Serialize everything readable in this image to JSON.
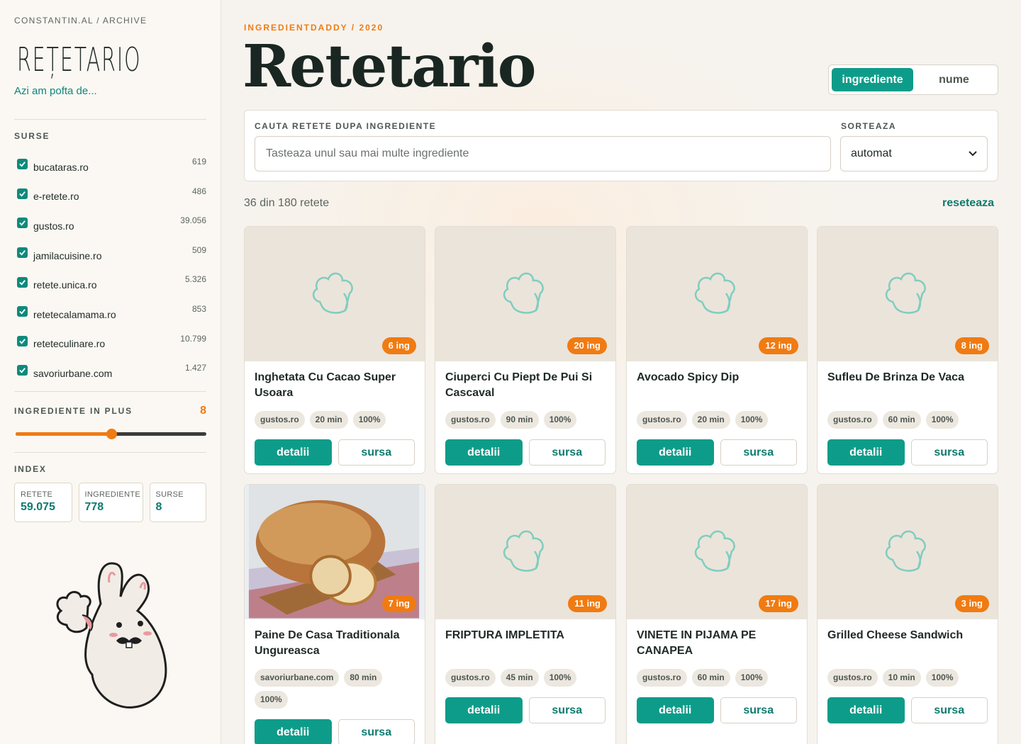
{
  "sidebar": {
    "crumb": "CONSTANTIN.AL / ARCHIVE",
    "logo": "REȚETARIO",
    "tagline": "Azi am pofta de...",
    "sources_title": "SURSE",
    "sources": [
      {
        "name": "bucataras.ro",
        "count": "619",
        "checked": true
      },
      {
        "name": "e-retete.ro",
        "count": "486",
        "checked": true
      },
      {
        "name": "gustos.ro",
        "count": "39.056",
        "checked": true
      },
      {
        "name": "jamilacuisine.ro",
        "count": "509",
        "checked": true
      },
      {
        "name": "retete.unica.ro",
        "count": "5.326",
        "checked": true
      },
      {
        "name": "retetecalamama.ro",
        "count": "853",
        "checked": true
      },
      {
        "name": "reteteculinare.ro",
        "count": "10.799",
        "checked": true
      },
      {
        "name": "savoriurbane.com",
        "count": "1.427",
        "checked": true
      }
    ],
    "ingredients_plus_title": "INGREDIENTE IN PLUS",
    "ingredients_plus_value": "8",
    "slider_fraction": 0.5,
    "index_title": "INDEX",
    "stats": [
      {
        "label": "RETETE",
        "value": "59.075"
      },
      {
        "label": "INGREDIENTE",
        "value": "778"
      },
      {
        "label": "SURSE",
        "value": "8"
      }
    ]
  },
  "header": {
    "kicker": "INGREDIENTDADDY / 2020",
    "title": "Retetario",
    "toggle": {
      "active": "ingrediente",
      "inactive": "nume"
    }
  },
  "search": {
    "label": "CAUTA RETETE DUPA INGREDIENTE",
    "placeholder": "Tasteaza unul sau mai multe ingrediente",
    "sort_label": "SORTEAZA",
    "sort_value": "automat"
  },
  "results": {
    "count_text": "36 din 180 retete",
    "reset_label": "reseteaza"
  },
  "card_labels": {
    "details": "detalii",
    "source": "sursa"
  },
  "recipes": [
    {
      "title": "Inghetata Cu Cacao Super Usoara",
      "ing": "6 ing",
      "source": "gustos.ro",
      "time": "20 min",
      "match": "100%",
      "image": "placeholder"
    },
    {
      "title": "Ciuperci Cu Piept De Pui Si Cascaval",
      "ing": "20 ing",
      "source": "gustos.ro",
      "time": "90 min",
      "match": "100%",
      "image": "placeholder"
    },
    {
      "title": "Avocado Spicy Dip",
      "ing": "12 ing",
      "source": "gustos.ro",
      "time": "20 min",
      "match": "100%",
      "image": "placeholder"
    },
    {
      "title": "Sufleu De Brinza De Vaca",
      "ing": "8 ing",
      "source": "gustos.ro",
      "time": "60 min",
      "match": "100%",
      "image": "placeholder"
    },
    {
      "title": "Paine De Casa Traditionala Ungureasca",
      "ing": "7 ing",
      "source": "savoriurbane.com",
      "time": "80 min",
      "match": "100%",
      "image": "bread-photo"
    },
    {
      "title": "FRIPTURA IMPLETITA",
      "ing": "11 ing",
      "source": "gustos.ro",
      "time": "45 min",
      "match": "100%",
      "image": "placeholder"
    },
    {
      "title": "VINETE IN PIJAMA PE CANAPEA",
      "ing": "17 ing",
      "source": "gustos.ro",
      "time": "60 min",
      "match": "100%",
      "image": "placeholder"
    },
    {
      "title": "Grilled Cheese Sandwich",
      "ing": "3 ing",
      "source": "gustos.ro",
      "time": "10 min",
      "match": "100%",
      "image": "placeholder"
    }
  ],
  "colors": {
    "accent": "#0e9c8a",
    "orange": "#f07b12",
    "text": "#1f2a26"
  }
}
